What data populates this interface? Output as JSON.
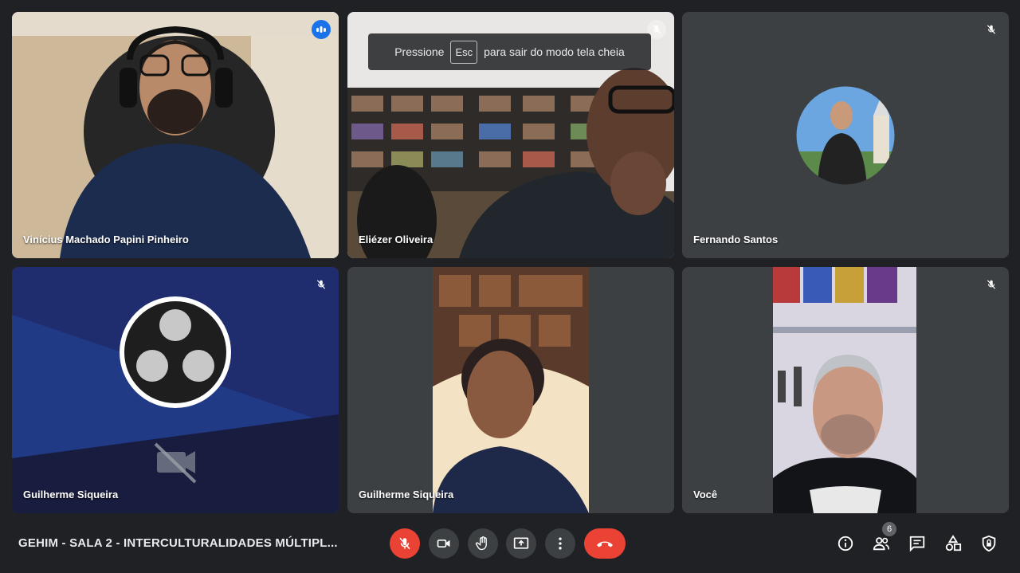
{
  "fullscreen_notice": {
    "before": "Pressione",
    "key": "Esc",
    "after": "para sair do modo tela cheia"
  },
  "participants": [
    {
      "name": "Vinícius Machado Papini Pinheiro"
    },
    {
      "name": "Eliézer Oliveira"
    },
    {
      "name": "Fernando Santos"
    },
    {
      "name": "Guilherme Siqueira"
    },
    {
      "name": "Guilherme Siqueira"
    },
    {
      "name": "Você"
    }
  ],
  "meeting": {
    "title": "GEHIM - SALA 2 - INTERCULTURALIDADES MÚLTIPL..."
  },
  "people_count": "6",
  "colors": {
    "background": "#202124",
    "tile": "#3c4043",
    "active_speaker": "#8ab4f8",
    "danger": "#ea4335",
    "accent": "#1a73e8"
  },
  "icons": {
    "speaking": "audio-level-icon",
    "muted": "mic-off-icon",
    "controls": [
      "mic-off-icon",
      "camera-icon",
      "raise-hand-icon",
      "present-screen-icon",
      "more-vert-icon",
      "call-end-icon"
    ],
    "right": [
      "info-icon",
      "people-icon",
      "chat-icon",
      "activities-icon",
      "host-controls-icon"
    ]
  }
}
